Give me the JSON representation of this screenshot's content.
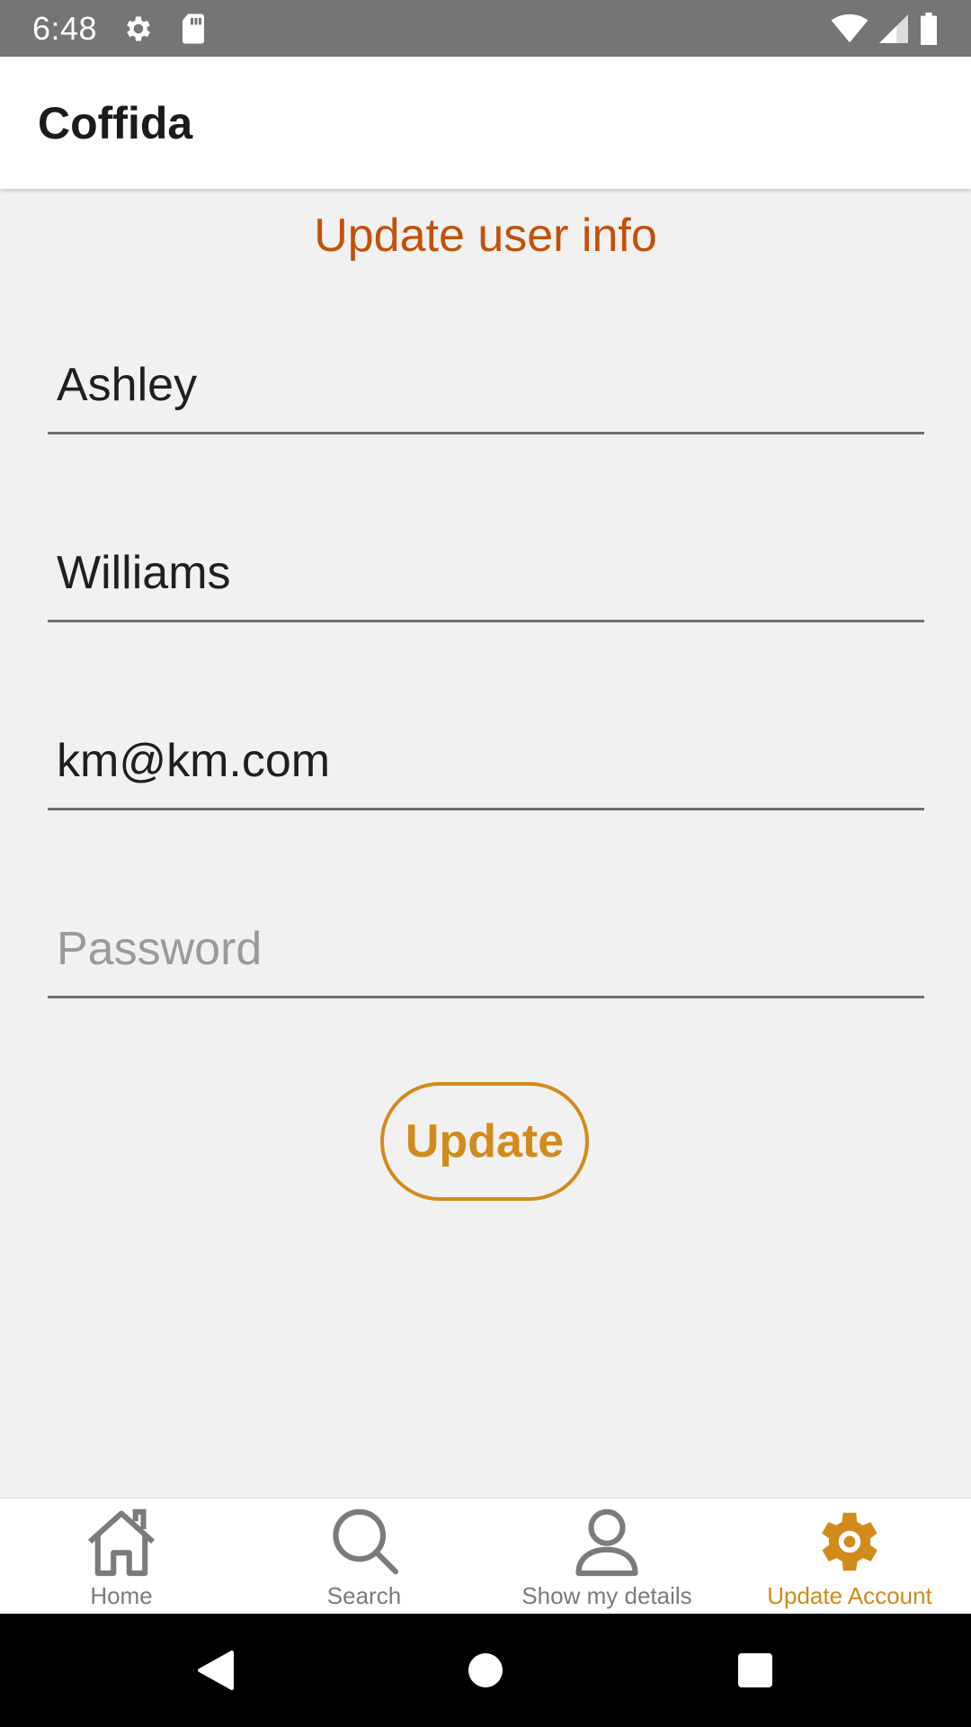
{
  "status_bar": {
    "time": "6:48",
    "icons": [
      "settings-icon",
      "sd-card-icon",
      "wifi-icon",
      "signal-icon",
      "battery-icon"
    ]
  },
  "app_bar": {
    "title": "Coffida"
  },
  "form": {
    "heading": "Update user info",
    "first_name": {
      "value": "Ashley",
      "placeholder": ""
    },
    "last_name": {
      "value": "Williams",
      "placeholder": ""
    },
    "email": {
      "value": "km@km.com",
      "placeholder": ""
    },
    "password": {
      "value": "",
      "placeholder": "Password"
    },
    "submit_label": "Update"
  },
  "tabs": [
    {
      "label": "Home",
      "icon": "home-icon",
      "active": false
    },
    {
      "label": "Search",
      "icon": "search-icon",
      "active": false
    },
    {
      "label": "Show my details",
      "icon": "person-icon",
      "active": false
    },
    {
      "label": "Update Account",
      "icon": "gear-icon",
      "active": true
    }
  ],
  "nav_bar": {
    "icons": [
      "back-icon",
      "home-circle-icon",
      "recents-icon"
    ]
  },
  "colors": {
    "accent": "#d18b1c",
    "heading": "#c4500a",
    "status_bar": "#757575",
    "inactive_tab": "#7b7b7b"
  }
}
